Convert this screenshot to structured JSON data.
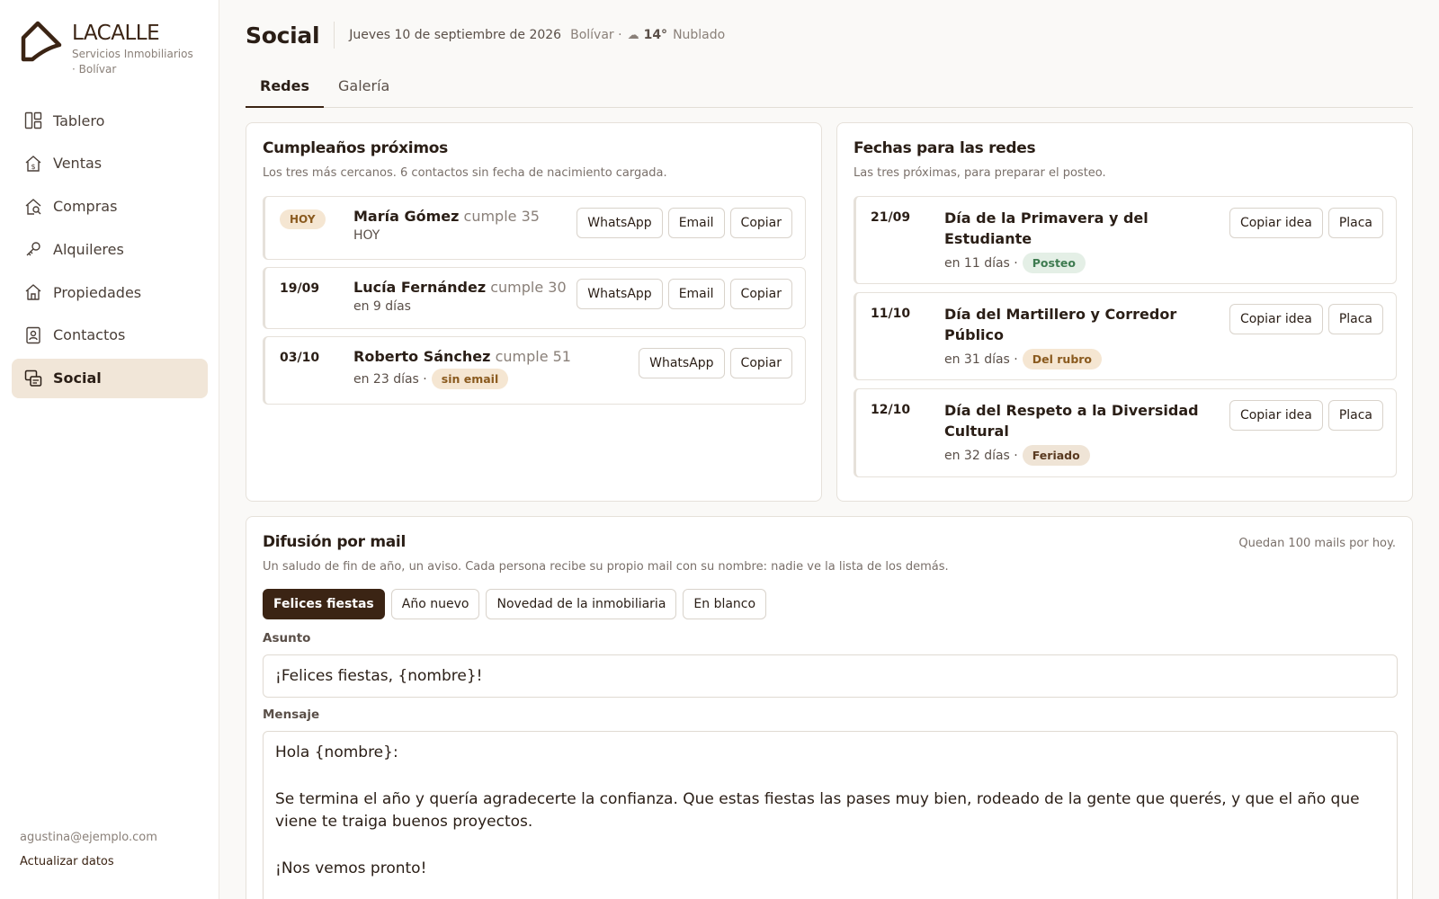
{
  "brand": {
    "name": "LACALLE",
    "subtitle": "Servicios Inmobiliarios · Bolívar"
  },
  "nav": {
    "items": [
      {
        "label": "Tablero",
        "icon": "dashboard-icon"
      },
      {
        "label": "Ventas",
        "icon": "house-dollar-icon"
      },
      {
        "label": "Compras",
        "icon": "house-search-icon"
      },
      {
        "label": "Alquileres",
        "icon": "key-icon"
      },
      {
        "label": "Propiedades",
        "icon": "home-icon"
      },
      {
        "label": "Contactos",
        "icon": "contacts-icon"
      },
      {
        "label": "Social",
        "icon": "social-icon",
        "active": true
      }
    ]
  },
  "user": {
    "email": "agustina@ejemplo.com",
    "update_label": "Actualizar datos"
  },
  "header": {
    "title": "Social",
    "date": "Jueves 10 de septiembre de 2026",
    "location": "Bolívar ·",
    "weather_icon": "☁",
    "temperature": "14°",
    "condition": "Nublado"
  },
  "tabs": [
    {
      "label": "Redes",
      "active": true
    },
    {
      "label": "Galería",
      "active": false
    }
  ],
  "birthdays": {
    "title": "Cumpleaños próximos",
    "subtitle": "Los tres más cercanos. 6 contactos sin fecha de nacimiento cargada.",
    "items": [
      {
        "date": "HOY",
        "name": "María Gómez",
        "age": "cumple 35",
        "when": "HOY",
        "buttons": [
          "WhatsApp",
          "Email",
          "Copiar"
        ]
      },
      {
        "date": "19/09",
        "name": "Lucía Fernández",
        "age": "cumple 30",
        "when": "en 9 días",
        "buttons": [
          "WhatsApp",
          "Email",
          "Copiar"
        ]
      },
      {
        "date": "03/10",
        "name": "Roberto Sánchez",
        "age": "cumple 51",
        "when": "en 23 días ·",
        "badge": "sin email",
        "buttons": [
          "WhatsApp",
          "Copiar"
        ]
      }
    ]
  },
  "events": {
    "title": "Fechas para las redes",
    "subtitle": "Las tres próximas, para preparar el posteo.",
    "items": [
      {
        "date": "21/09",
        "name": "Día de la Primavera y del Estudiante",
        "when": "en 11 días ·",
        "badge": "Posteo",
        "buttons": [
          "Copiar idea",
          "Placa"
        ]
      },
      {
        "date": "11/10",
        "name": "Día del Martillero y Corredor Público",
        "when": "en 31 días ·",
        "badge": "Del rubro",
        "buttons": [
          "Copiar idea",
          "Placa"
        ]
      },
      {
        "date": "12/10",
        "name": "Día del Respeto a la Diversidad Cultural",
        "when": "en 32 días ·",
        "badge": "Feriado",
        "buttons": [
          "Copiar idea",
          "Placa"
        ]
      }
    ]
  },
  "mail": {
    "title": "Difusión por mail",
    "quota": "Quedan 100 mails por hoy.",
    "subtitle": "Un saludo de fin de año, un aviso. Cada persona recibe su propio mail con su nombre: nadie ve la lista de los demás.",
    "templates": [
      {
        "label": "Felices fiestas",
        "active": true
      },
      {
        "label": "Año nuevo",
        "active": false
      },
      {
        "label": "Novedad de la inmobiliaria",
        "active": false
      },
      {
        "label": "En blanco",
        "active": false
      }
    ],
    "subject_label": "Asunto",
    "subject_value": "¡Felices fiestas, {nombre}!",
    "message_label": "Mensaje",
    "message_value": "Hola {nombre}:\n\nSe termina el año y quería agradecerte la confianza. Que estas fiestas las pases muy bien, rodeado de la gente que querés, y que el año que viene te traiga buenos proyectos.\n\n¡Nos vemos pronto!"
  },
  "colors": {
    "accent": "#3b2414",
    "active_bg": "#f1e6d8",
    "green_badge": "#3e7b50",
    "warn_badge": "#8a5a1e"
  }
}
